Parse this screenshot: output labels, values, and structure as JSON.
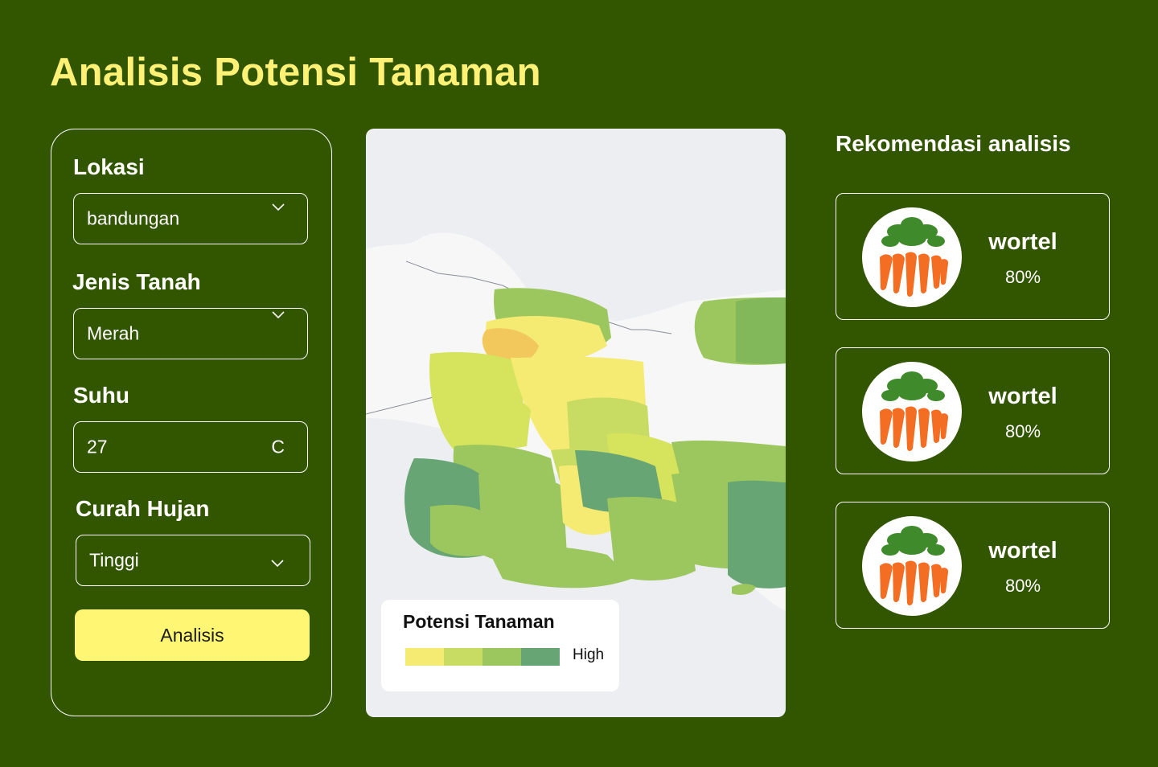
{
  "page": {
    "title": "Analisis Potensi Tanaman"
  },
  "form": {
    "location": {
      "label": "Lokasi",
      "value": "bandungan",
      "icon": "chevron-down-icon"
    },
    "soil": {
      "label": "Jenis Tanah",
      "value": "Merah",
      "icon": "chevron-down-icon"
    },
    "temperature": {
      "label": "Suhu",
      "value": "27",
      "unit": "C"
    },
    "rainfall": {
      "label": "Curah Hujan",
      "value": "Tinggi",
      "icon": "chevron-down-icon"
    },
    "submit_label": "Analisis"
  },
  "map": {
    "legend": {
      "title": "Potensi Tanaman",
      "high_label": "High",
      "colors": [
        "#F5EB73",
        "#C8DB62",
        "#9CC65E",
        "#68A574"
      ]
    }
  },
  "recommendations": {
    "title": "Rekomendasi analisis",
    "items": [
      {
        "name": "wortel",
        "percent": "80%",
        "image": "carrot-image"
      },
      {
        "name": "wortel",
        "percent": "80%",
        "image": "carrot-image"
      },
      {
        "name": "wortel",
        "percent": "80%",
        "image": "carrot-image"
      }
    ]
  },
  "colors": {
    "background": "#325600",
    "title_accent": "#FFF176",
    "button": "#FFF773"
  }
}
